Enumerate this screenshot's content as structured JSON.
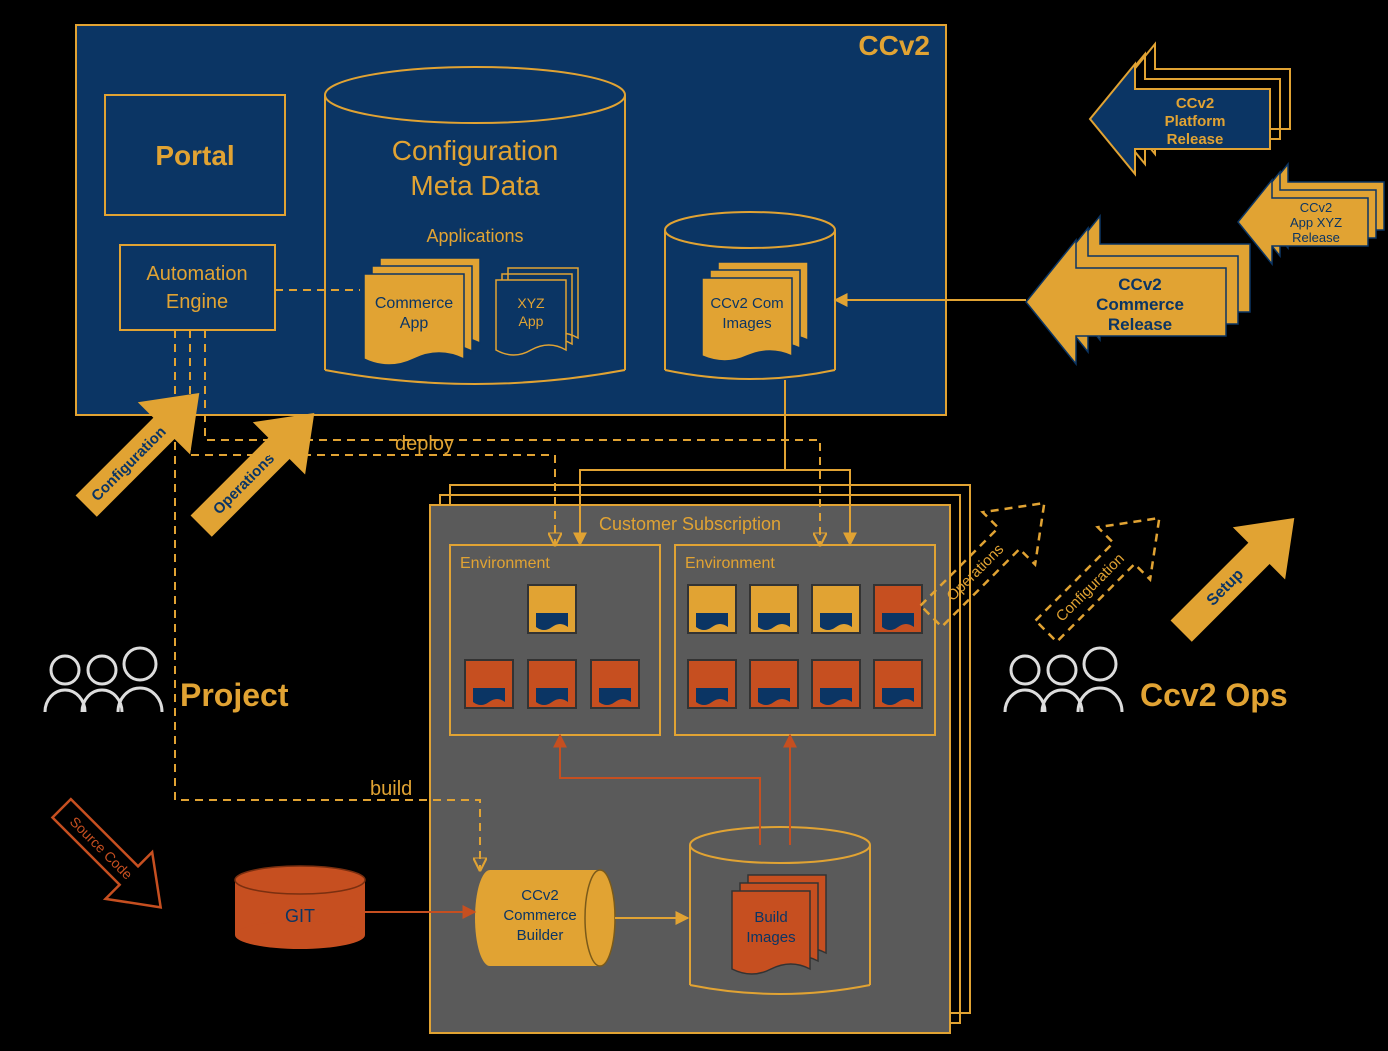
{
  "ccv2": {
    "title": "CCv2",
    "portal": "Portal",
    "automation_engine_l1": "Automation",
    "automation_engine_l2": "Engine",
    "config_meta_l1": "Configuration",
    "config_meta_l2": "Meta Data",
    "applications_label": "Applications",
    "commerce_app_l1": "Commerce",
    "commerce_app_l2": "App",
    "xyz_app_l1": "XYZ",
    "xyz_app_l2": "App",
    "com_images_l1": "CCv2 Com",
    "com_images_l2": "Images"
  },
  "subscription": {
    "title": "Customer Subscription",
    "env_label_1": "Environment",
    "env_label_2": "Environment",
    "builder_l1": "CCv2",
    "builder_l2": "Commerce",
    "builder_l3": "Builder",
    "build_images_l1": "Build",
    "build_images_l2": "Images"
  },
  "labels": {
    "deploy": "deploy",
    "build": "build"
  },
  "left": {
    "configuration": "Configuration",
    "operations": "Operations",
    "project": "Project",
    "source_code": "Source Code",
    "git": "GIT"
  },
  "right": {
    "operations": "Operations",
    "configuration": "Configuration",
    "setup": "Setup",
    "ccv2_ops": "Ccv2 Ops",
    "platform_release_l1": "CCv2",
    "platform_release_l2": "Platform",
    "platform_release_l3": "Release",
    "app_xyz_l1": "CCv2",
    "app_xyz_l2": "App XYZ",
    "app_xyz_l3": "Release",
    "commerce_release_l1": "CCv2",
    "commerce_release_l2": "Commerce",
    "commerce_release_l3": "Release"
  },
  "colors": {
    "orange": "#e1a333",
    "blue": "#0b3564",
    "red": "#c64f20",
    "gray": "#5a5a5a"
  }
}
